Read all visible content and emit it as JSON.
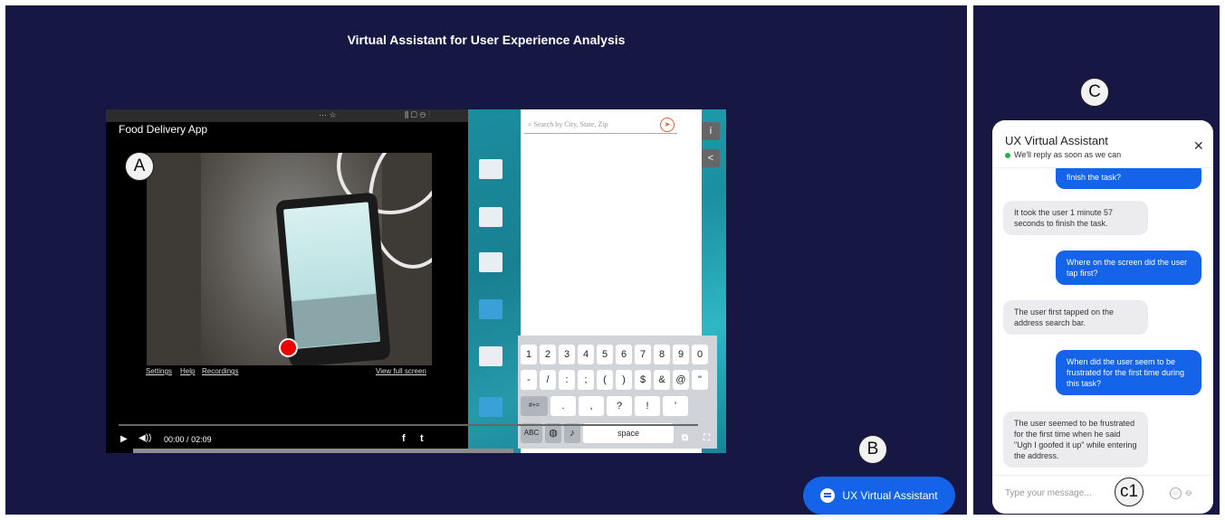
{
  "page": {
    "title": "Virtual Assistant for User Experience Analysis"
  },
  "labels": {
    "a": "A",
    "b": "B",
    "c": "C",
    "c1": "c1"
  },
  "video": {
    "title": "Food Delivery App",
    "links": {
      "settings": "Settings",
      "help": "Help",
      "recordings": "Recordings",
      "full_screen": "View full screen"
    },
    "time_current": "00:00",
    "time_separator": "/",
    "time_total": "02:09",
    "progress": 0,
    "search_placeholder": "Search by City, State, Zip",
    "keyboard": {
      "row1": [
        "1",
        "2",
        "3",
        "4",
        "5",
        "6",
        "7",
        "8",
        "9",
        "0"
      ],
      "row2": [
        "-",
        "/",
        ":",
        ";",
        "(",
        ")",
        "$",
        "&",
        "@",
        "\""
      ],
      "row3": [
        "#+=",
        ".",
        ",",
        "?",
        "!",
        "'"
      ],
      "abc": "ABC",
      "space": "space"
    }
  },
  "ux_button": {
    "label": "UX Virtual Assistant"
  },
  "chat": {
    "title": "UX Virtual Assistant",
    "status": "We'll reply as soon as we can",
    "input_placeholder": "Type your message...",
    "messages": [
      {
        "from": "user",
        "text": "finish the task?"
      },
      {
        "from": "bot",
        "text": "It took the user 1 minute 57 seconds to finish the task."
      },
      {
        "from": "user",
        "text": "Where on the screen did the user tap first?"
      },
      {
        "from": "bot",
        "text": "The user first tapped on the address search bar."
      },
      {
        "from": "user",
        "text": "When did the user seem to be frustrated for the first time during this task?"
      },
      {
        "from": "bot",
        "text": "The user seemed to be frustrated for the first time when he said \"Ugh I goofed it up\" while entering the address."
      }
    ]
  },
  "icons": {
    "play": "play-icon",
    "volume": "volume-icon",
    "facebook": "facebook-icon",
    "twitter": "twitter-icon",
    "info": "info-icon",
    "share": "share-icon",
    "close": "close-icon",
    "emoji": "emoji-icon",
    "attach": "paperclip-icon",
    "chat": "chat-bubble-icon"
  },
  "colors": {
    "background": "#171744",
    "accent": "#1463e8",
    "online": "#22b14c"
  }
}
